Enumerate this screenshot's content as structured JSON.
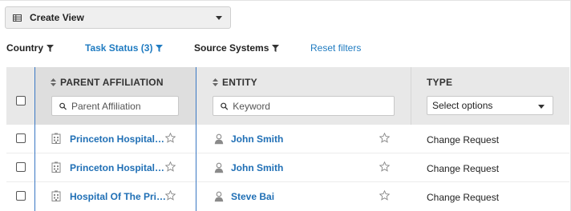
{
  "toolbar": {
    "create_view_label": "Create View",
    "grid_icon": "table-grid-icon"
  },
  "filters": {
    "country_label": "Country",
    "task_status_label": "Task Status (3)",
    "source_systems_label": "Source Systems",
    "reset_label": "Reset filters",
    "active_color": "#1f7bc1"
  },
  "table": {
    "columns": {
      "parent_affiliation": {
        "label": "PARENT AFFILIATION",
        "placeholder": "Parent Affiliation"
      },
      "entity": {
        "label": "ENTITY",
        "placeholder": "Keyword"
      },
      "type": {
        "label": "TYPE",
        "select_value": "Select options"
      }
    },
    "rows": [
      {
        "parent": "Princeton Hospital…",
        "entity": "John Smith",
        "type": "Change Request"
      },
      {
        "parent": "Princeton Hospital…",
        "entity": "John Smith",
        "type": "Change Request"
      },
      {
        "parent": "Hospital Of The Pri…",
        "entity": "Steve Bai",
        "type": "Change Request"
      }
    ],
    "icons": {
      "parent": "hospital-building-icon",
      "entity": "person-icon",
      "favorite": "star-icon"
    },
    "colors": {
      "link": "#1f6fb5",
      "column_separator": "#3a78c3",
      "header_bg": "#e8e8e8"
    }
  }
}
